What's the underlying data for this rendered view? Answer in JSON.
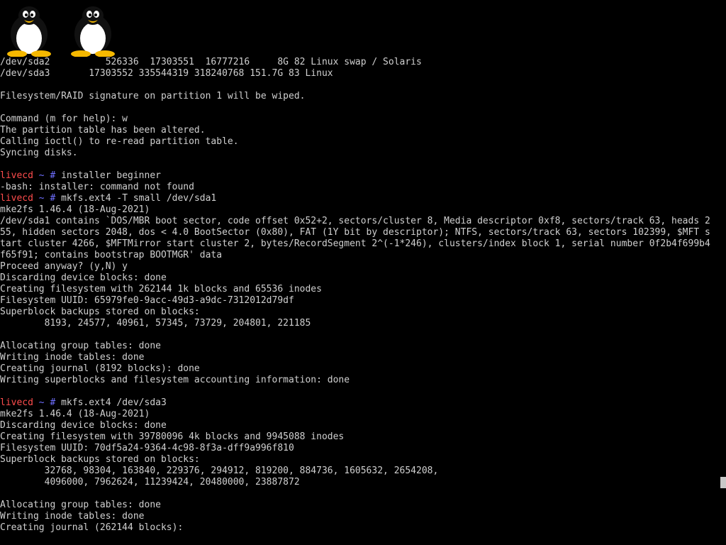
{
  "prompt": {
    "host": "livecd",
    "tilde": "~",
    "hash": "#",
    "host_color": "#ff4d4d",
    "path_color": "#6f6fff"
  },
  "colors": {
    "background": "#000000",
    "text": "#d0d0d0"
  },
  "logos": [
    {
      "icon": "tux-penguin-icon"
    },
    {
      "icon": "tux-penguin-icon"
    }
  ],
  "lines": [
    {
      "text": "/dev/sda2          526336  17303551  16777216     8G 82 Linux swap / Solaris"
    },
    {
      "text": "/dev/sda3       17303552 335544319 318240768 151.7G 83 Linux"
    },
    {
      "text": ""
    },
    {
      "text": "Filesystem/RAID signature on partition 1 will be wiped."
    },
    {
      "text": ""
    },
    {
      "text": "Command (m for help): w"
    },
    {
      "text": "The partition table has been altered."
    },
    {
      "text": "Calling ioctl() to re-read partition table."
    },
    {
      "text": "Syncing disks."
    },
    {
      "text": ""
    },
    {
      "prompt": true,
      "command": "installer beginner"
    },
    {
      "text": "-bash: installer: command not found"
    },
    {
      "prompt": true,
      "command": "mkfs.ext4 -T small /dev/sda1"
    },
    {
      "text": "mke2fs 1.46.4 (18-Aug-2021)"
    },
    {
      "text": "/dev/sda1 contains `DOS/MBR boot sector, code offset 0x52+2, sectors/cluster 8, Media descriptor 0xf8, sectors/track 63, heads 2"
    },
    {
      "text": "55, hidden sectors 2048, dos < 4.0 BootSector (0x80), FAT (1Y bit by descriptor); NTFS, sectors/track 63, sectors 102399, $MFT s"
    },
    {
      "text": "tart cluster 4266, $MFTMirror start cluster 2, bytes/RecordSegment 2^(-1*246), clusters/index block 1, serial number 0f2b4f699b4"
    },
    {
      "text": "f65f91; contains bootstrap BOOTMGR' data"
    },
    {
      "text": "Proceed anyway? (y,N) y"
    },
    {
      "text": "Discarding device blocks: done"
    },
    {
      "text": "Creating filesystem with 262144 1k blocks and 65536 inodes"
    },
    {
      "text": "Filesystem UUID: 65979fe0-9acc-49d3-a9dc-7312012d79df"
    },
    {
      "text": "Superblock backups stored on blocks:"
    },
    {
      "text": "        8193, 24577, 40961, 57345, 73729, 204801, 221185"
    },
    {
      "text": ""
    },
    {
      "text": "Allocating group tables: done"
    },
    {
      "text": "Writing inode tables: done"
    },
    {
      "text": "Creating journal (8192 blocks): done"
    },
    {
      "text": "Writing superblocks and filesystem accounting information: done"
    },
    {
      "text": ""
    },
    {
      "prompt": true,
      "command": "mkfs.ext4 /dev/sda3"
    },
    {
      "text": "mke2fs 1.46.4 (18-Aug-2021)"
    },
    {
      "text": "Discarding device blocks: done"
    },
    {
      "text": "Creating filesystem with 39780096 4k blocks and 9945088 inodes"
    },
    {
      "text": "Filesystem UUID: 70df5a24-9364-4c98-8f3a-dff9a996f810"
    },
    {
      "text": "Superblock backups stored on blocks:"
    },
    {
      "text": "        32768, 98304, 163840, 229376, 294912, 819200, 884736, 1605632, 2654208,"
    },
    {
      "text": "        4096000, 7962624, 11239424, 20480000, 23887872"
    },
    {
      "text": ""
    },
    {
      "text": "Allocating group tables: done"
    },
    {
      "text": "Writing inode tables: done"
    },
    {
      "text": "Creating journal (262144 blocks):"
    }
  ]
}
